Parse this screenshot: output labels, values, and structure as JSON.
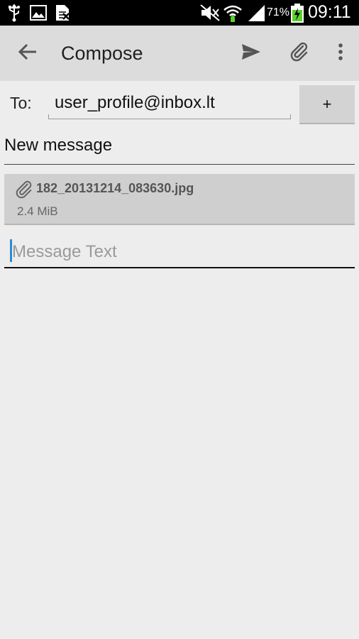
{
  "status_bar": {
    "battery_percent": "71%",
    "time": "09:11",
    "icons": [
      "usb-icon",
      "image-icon",
      "sim-icon",
      "mute-icon",
      "wifi-icon",
      "signal-icon",
      "battery-charging-icon"
    ]
  },
  "action_bar": {
    "title": "Compose",
    "icons": [
      "back-arrow-icon",
      "send-icon",
      "attach-icon",
      "overflow-menu-icon"
    ]
  },
  "compose": {
    "to_label": "To:",
    "to_value": "user_profile@inbox.lt",
    "add_button_label": "+",
    "subject": "New message",
    "attachment": {
      "name": "182_20131214_083630.jpg",
      "size": "2.4 MiB"
    },
    "message_placeholder": "Message Text"
  },
  "colors": {
    "background": "#ededed",
    "action_bar": "#dcdcdc",
    "status_bar": "#000000",
    "accent_caret": "#2a8cd8",
    "battery": "#5bd12a"
  }
}
